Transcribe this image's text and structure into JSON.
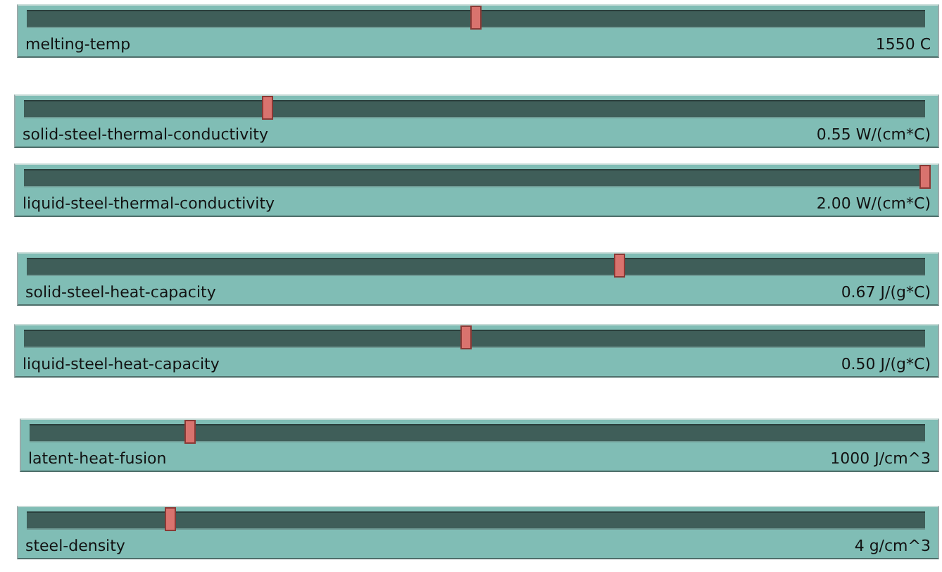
{
  "sliders": [
    {
      "name": "melting-temp",
      "level": 0.5,
      "reading": "1550 C"
    },
    {
      "name": "solid-steel-thermal-conductivity",
      "level": 0.27,
      "reading": "0.55 W/(cm*C)"
    },
    {
      "name": "liquid-steel-thermal-conductivity",
      "level": 1.0,
      "reading": "2.00 W/(cm*C)"
    },
    {
      "name": "solid-steel-heat-capacity",
      "level": 0.66,
      "reading": "0.67 J/(g*C)"
    },
    {
      "name": "liquid-steel-heat-capacity",
      "level": 0.49,
      "reading": "0.50 J/(g*C)"
    },
    {
      "name": "latent-heat-fusion",
      "level": 0.18,
      "reading": "1000 J/cm^3"
    },
    {
      "name": "steel-density",
      "level": 0.16,
      "reading": "4 g/cm^3"
    }
  ]
}
